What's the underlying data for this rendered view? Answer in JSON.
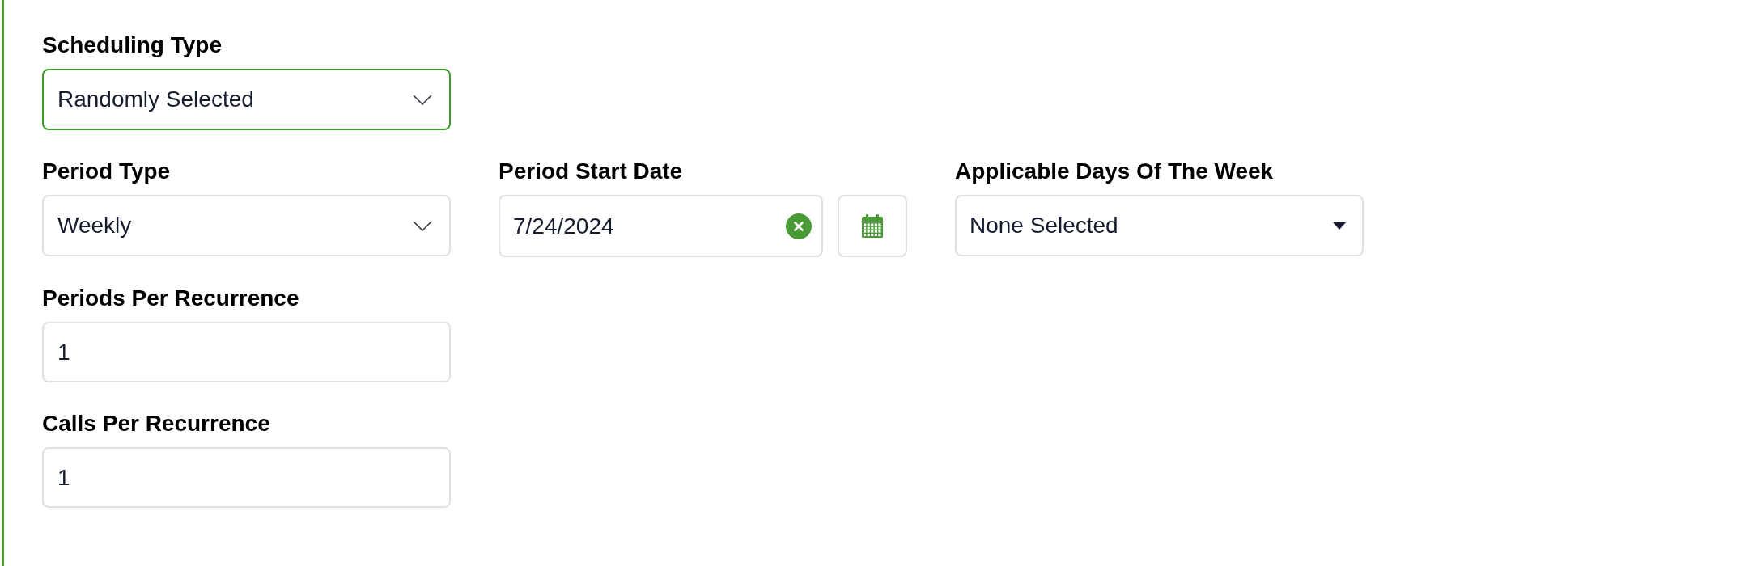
{
  "rows": [
    {
      "fields": [
        {
          "kind": "select",
          "label": "Scheduling Type",
          "value": "Randomly Selected",
          "focused": true
        }
      ]
    },
    {
      "fields": [
        {
          "kind": "select",
          "label": "Period Type",
          "value": "Weekly",
          "focused": false
        },
        {
          "kind": "date",
          "label": "Period Start Date",
          "value": "7/24/2024",
          "focused": false
        },
        {
          "kind": "multiselect",
          "label": "Applicable Days Of The Week",
          "value": "None Selected",
          "focused": false
        }
      ]
    },
    {
      "fields": [
        {
          "kind": "number",
          "label": "Periods Per Recurrence",
          "value": "1",
          "focused": false
        }
      ]
    },
    {
      "fields": [
        {
          "kind": "number",
          "label": "Calls Per Recurrence",
          "value": "1",
          "focused": false
        }
      ]
    }
  ]
}
